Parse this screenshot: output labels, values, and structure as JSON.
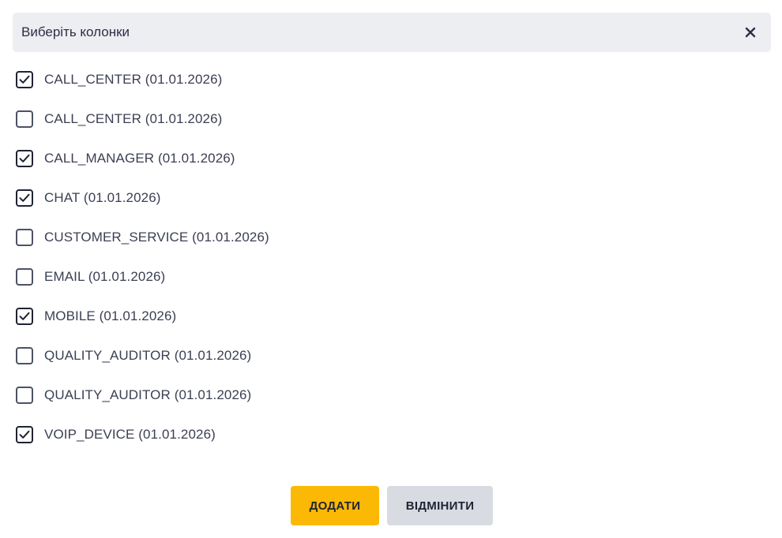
{
  "header": {
    "title": "Виберіть колонки",
    "close_icon": "close-icon"
  },
  "columns": [
    {
      "label": "CALL_CENTER (01.01.2026)",
      "checked": true
    },
    {
      "label": "CALL_CENTER (01.01.2026)",
      "checked": false
    },
    {
      "label": "CALL_MANAGER (01.01.2026)",
      "checked": true
    },
    {
      "label": "CHAT (01.01.2026)",
      "checked": true
    },
    {
      "label": "CUSTOMER_SERVICE (01.01.2026)",
      "checked": false
    },
    {
      "label": "EMAIL (01.01.2026)",
      "checked": false
    },
    {
      "label": "MOBILE (01.01.2026)",
      "checked": true
    },
    {
      "label": "QUALITY_AUDITOR (01.01.2026)",
      "checked": false
    },
    {
      "label": "QUALITY_AUDITOR (01.01.2026)",
      "checked": false
    },
    {
      "label": "VOIP_DEVICE (01.01.2026)",
      "checked": true
    }
  ],
  "actions": {
    "add_label": "ДОДАТИ",
    "cancel_label": "ВІДМІНИТИ"
  },
  "colors": {
    "header_bg": "#edeef2",
    "primary": "#fbb805",
    "secondary": "#d9dbe3",
    "text": "#2b2f45"
  }
}
